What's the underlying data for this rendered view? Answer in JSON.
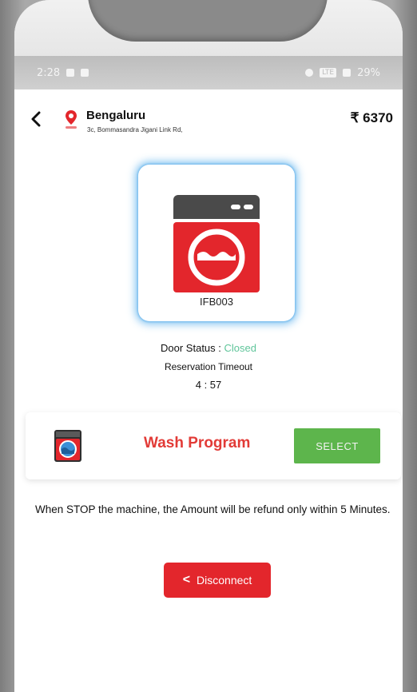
{
  "status_bar": {
    "time": "2:28",
    "right_text": "29%"
  },
  "header": {
    "back_icon": "chevron-left-icon",
    "location_icon": "map-pin-icon",
    "location_name": "Bengaluru",
    "location_address": "3c, Bommasandra Jigani Link Rd,",
    "price": "₹ 6370"
  },
  "machine": {
    "icon": "washing-machine-icon",
    "id": "IFB003",
    "door_status_label": "Door Status : ",
    "door_status_value": "Closed",
    "reservation_label": "Reservation Timeout",
    "timer": "4 : 57"
  },
  "wash_program": {
    "icon": "washing-machine-small-icon",
    "label": "Wash Program",
    "button": "SELECT"
  },
  "notice": "When STOP the machine, the Amount will be refund only within 5 Minutes.",
  "disconnect": {
    "chevron": "<",
    "label": "Disconnect"
  },
  "colors": {
    "accent_red": "#e3262c",
    "select_green": "#5db54c",
    "closed_teal": "#5fc59a",
    "card_glow": "#78bef0"
  }
}
